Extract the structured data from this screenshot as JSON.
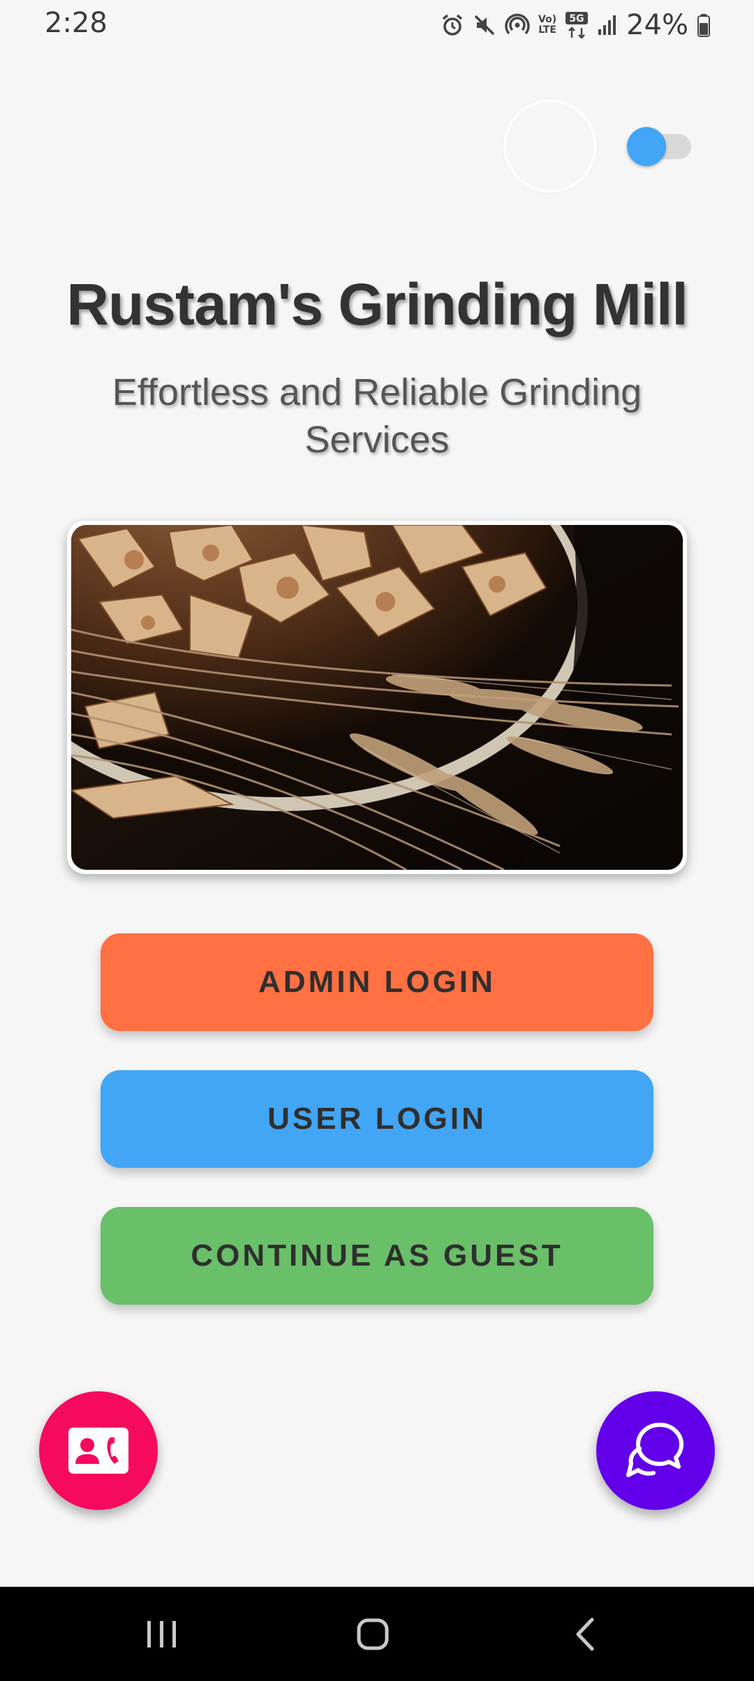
{
  "status_bar": {
    "time": "2:28",
    "network_volte_label": "Vo)\nLTE",
    "network_5g_label": "5G",
    "battery_percent": "24%",
    "icons": [
      "alarm-icon",
      "mute-icon",
      "hotspot-icon",
      "volte-icon",
      "5g-icon",
      "signal-icon",
      "battery-icon"
    ]
  },
  "header": {
    "title": "Rustam's Grinding Mill",
    "subtitle": "Effortless and Reliable Grinding Services"
  },
  "theme_toggle": {
    "state": "on",
    "accent_color": "#42a5f5"
  },
  "hero_image": {
    "icon": "wheat-and-pie-photo"
  },
  "buttons": {
    "admin_login": "ADMIN LOGIN",
    "user_login": "USER LOGIN",
    "continue_guest": "CONTINUE AS GUEST"
  },
  "colors": {
    "admin_button": "#ff7043",
    "user_button": "#42a5f5",
    "guest_button": "#6abf69",
    "contact_fab": "#f50a5e",
    "chat_fab": "#6200ea",
    "background": "#f6f6f6"
  },
  "fabs": {
    "contact_icon": "contact-card-icon",
    "chat_icon": "chat-bubbles-icon"
  },
  "nav_bar": {
    "icons": [
      "recent-apps-icon",
      "home-icon",
      "back-icon"
    ]
  }
}
